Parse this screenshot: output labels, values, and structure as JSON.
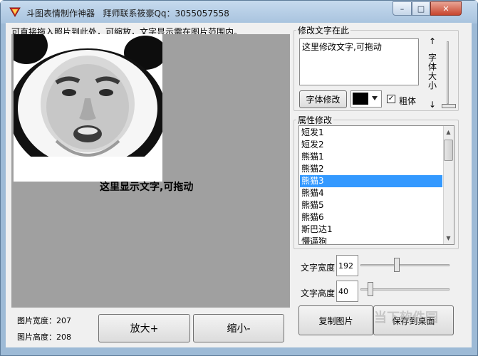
{
  "window": {
    "title": "斗图表情制作神器   拜师联系筱豪Qq：3055057558",
    "controls": {
      "minimize": "–",
      "maximize": "□",
      "close": "✕"
    }
  },
  "canvas": {
    "hint": "可直接拖入照片到此处，可缩放，文字显示需在图片范围内。",
    "overlay_text": "这里显示文字,可拖动",
    "width_label": "图片宽度：207",
    "height_label": "图片高度：208",
    "zoom_in_label": "放大+",
    "zoom_out_label": "缩小-"
  },
  "text_panel": {
    "title": "修改文字在此",
    "text_value": "这里修改文字,可拖动",
    "font_size_label": "字体大小",
    "font_size_arrows": {
      "up": "↑",
      "down": "↓"
    },
    "font_button": "字体修改",
    "color": "#000000",
    "bold_checked": true,
    "bold_check_glyph": "✓",
    "bold_label": "粗体"
  },
  "properties": {
    "title": "属性修改",
    "items": [
      "短发1",
      "短发2",
      "熊猫1",
      "熊猫2",
      "熊猫3",
      "熊猫4",
      "熊猫5",
      "熊猫6",
      "斯巴达1",
      "懵逼狗"
    ],
    "selected_index": 4,
    "scroll_arrows": {
      "up": "▲",
      "down": "▼"
    }
  },
  "sliders": {
    "width_label": "文字宽度",
    "width_value": "192",
    "height_label": "文字高度",
    "height_value": "40"
  },
  "actions": {
    "copy_label": "复制图片",
    "save_label": "保存到桌面"
  },
  "watermark": "当下软件园"
}
